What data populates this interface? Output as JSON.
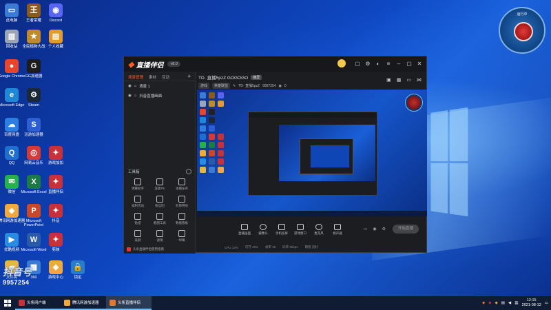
{
  "desktop": {
    "icons": [
      {
        "label": "此电脑",
        "color": "#3a7bd5",
        "glyph": "▭"
      },
      {
        "label": "王者荣耀",
        "color": "#8a5a1e",
        "glyph": "王"
      },
      {
        "label": "Discord",
        "color": "#5865f2",
        "glyph": "◉"
      },
      {
        "label": "回收站",
        "color": "#9aa6b8",
        "glyph": "▥"
      },
      {
        "label": "全民植物大战",
        "color": "#c08a2a",
        "glyph": "★"
      },
      {
        "label": "个人收藏",
        "color": "#e79a2c",
        "glyph": "▤"
      },
      {
        "label": "Google Chrome",
        "color": "#e7452c",
        "glyph": "●"
      },
      {
        "label": "GG加速器",
        "color": "#1c1c1c",
        "glyph": "G"
      },
      {
        "label": "Microsoft Edge",
        "color": "#1e88d6",
        "glyph": "e"
      },
      {
        "label": "Steam",
        "color": "#1b2838",
        "glyph": "⚙"
      },
      {
        "label": "百度网盘",
        "color": "#2c7fe0",
        "glyph": "☁"
      },
      {
        "label": "迅游加速器",
        "color": "#2d5fd3",
        "glyph": "S"
      },
      {
        "label": "QQ",
        "color": "#1f6fd1",
        "glyph": "Q"
      },
      {
        "label": "网易云音乐",
        "color": "#d53a3a",
        "glyph": "◎"
      },
      {
        "label": "游戏加加",
        "color": "#c9313a",
        "glyph": "✦"
      },
      {
        "label": "微信",
        "color": "#24b34b",
        "glyph": "✉"
      },
      {
        "label": "Microsoft Excel",
        "color": "#1d7a45",
        "glyph": "X"
      },
      {
        "label": "直播伴侣",
        "color": "#c9313a",
        "glyph": "✦"
      },
      {
        "label": "腾讯网游加速器",
        "color": "#f2a93b",
        "glyph": "◆"
      },
      {
        "label": "Microsoft PowerPoint",
        "color": "#c9482a",
        "glyph": "P"
      },
      {
        "label": "抖音",
        "color": "#c9313a",
        "glyph": "✦"
      },
      {
        "label": "优酷视频",
        "color": "#2a8ce0",
        "glyph": "▶"
      },
      {
        "label": "Microsoft Word",
        "color": "#2a5aa8",
        "glyph": "W"
      },
      {
        "label": "剪映",
        "color": "#c9313a",
        "glyph": "✦"
      },
      {
        "label": "文件夹",
        "color": "#e6b54a",
        "glyph": "▰"
      },
      {
        "label": "360",
        "color": "#3a7bd5",
        "glyph": "▦"
      },
      {
        "label": "游戏中心",
        "color": "#f2a93b",
        "glyph": "◈"
      },
      {
        "label": "锁定",
        "color": "#2a7bc8",
        "glyph": "🔒"
      }
    ],
    "gadget_label": "运行中",
    "watermark_brand": "抖音号",
    "watermark_id": "9957254"
  },
  "app": {
    "name": "直播伴侣",
    "version": "v8.0",
    "left_tabs": [
      "场景管理",
      "素材",
      "互动"
    ],
    "scenes": [
      "场景 1",
      "抖音直播画面"
    ],
    "tools_title": "工具箱",
    "tools": [
      "弹幕助手",
      "连麦PK",
      "主播任务",
      "福利活动",
      "粉丝团",
      "礼物特效",
      "贴纸",
      "截图工具",
      "数据看板",
      "美颜",
      "滤镜",
      "绿幕"
    ],
    "announcement": "头条直播伴侣使用指南",
    "room_title": "TD· 直播5pzZ GOGOGO",
    "room_badge": "横屏",
    "room_tags": [
      "游戏",
      "英雄联盟",
      "TD· 直播5pzZ",
      "9957254",
      "0"
    ],
    "controls": [
      "直播画面",
      "摄像头",
      "手机投屏",
      "游戏窗口",
      "麦克风",
      "扬声器"
    ],
    "go_live": "开始直播",
    "status": [
      "CPU 12%",
      "内存 45%",
      "帧率 30",
      "码率 0kbps",
      "网络 良好"
    ]
  },
  "taskbar": {
    "apps": [
      {
        "label": "头条网户端",
        "color": "#c9313a"
      },
      {
        "label": "腾讯网游加速器",
        "color": "#f2a93b"
      },
      {
        "label": "头条直播伴侣",
        "color": "#e9752c"
      }
    ],
    "tray_lang": "英",
    "time": "12:15",
    "date": "2021-08-12"
  }
}
